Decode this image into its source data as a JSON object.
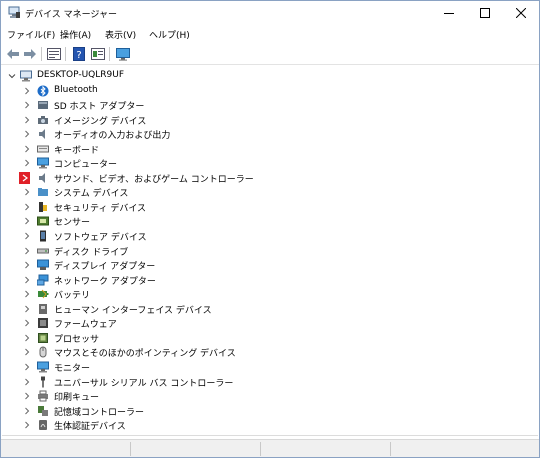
{
  "window": {
    "title": "デバイス マネージャー",
    "icon": "device-manager-icon",
    "controls": [
      "minimize-icon",
      "maximize-icon",
      "close-icon"
    ]
  },
  "menu": {
    "items": [
      "ファイル(F)",
      "操作(A)",
      "表示(V)",
      "ヘルプ(H)"
    ]
  },
  "toolbar": {
    "buttons": [
      "back-arrow-icon",
      "forward-arrow-icon",
      "properties-icon",
      "help-icon",
      "view-icon",
      "monitor-icon"
    ]
  },
  "tree": {
    "root": {
      "label": "DESKTOP-UQLR9UF",
      "expanded": true,
      "icon": "computer-icon"
    },
    "items": [
      {
        "label": "Bluetooth",
        "icon": "bluetooth-icon"
      },
      {
        "label": "SD ホスト アダプター",
        "icon": "sd-card-icon"
      },
      {
        "label": "イメージング デバイス",
        "icon": "camera-icon"
      },
      {
        "label": "オーディオの入力および出力",
        "icon": "speaker-icon"
      },
      {
        "label": "キーボード",
        "icon": "keyboard-icon"
      },
      {
        "label": "コンピューター",
        "icon": "monitor-icon"
      },
      {
        "label": "サウンド、ビデオ、およびゲーム コントローラー",
        "icon": "speaker-icon",
        "highlight": true
      },
      {
        "label": "システム デバイス",
        "icon": "folder-chip-icon"
      },
      {
        "label": "セキュリティ デバイス",
        "icon": "security-key-icon"
      },
      {
        "label": "センサー",
        "icon": "sensor-icon"
      },
      {
        "label": "ソフトウェア デバイス",
        "icon": "phone-device-icon"
      },
      {
        "label": "ディスク ドライブ",
        "icon": "disk-drive-icon"
      },
      {
        "label": "ディスプレイ アダプター",
        "icon": "display-adapter-icon"
      },
      {
        "label": "ネットワーク アダプター",
        "icon": "network-icon"
      },
      {
        "label": "バッテリ",
        "icon": "battery-icon"
      },
      {
        "label": "ヒューマン インターフェイス デバイス",
        "icon": "hid-icon"
      },
      {
        "label": "ファームウェア",
        "icon": "firmware-icon"
      },
      {
        "label": "プロセッサ",
        "icon": "processor-icon"
      },
      {
        "label": "マウスとそのほかのポインティング デバイス",
        "icon": "mouse-icon"
      },
      {
        "label": "モニター",
        "icon": "monitor-icon"
      },
      {
        "label": "ユニバーサル シリアル バス コントローラー",
        "icon": "usb-icon"
      },
      {
        "label": "印刷キュー",
        "icon": "printer-icon"
      },
      {
        "label": "記憶域コントローラー",
        "icon": "storage-controller-icon"
      },
      {
        "label": "生体認証デバイス",
        "icon": "fingerprint-icon"
      }
    ]
  },
  "colors": {
    "highlight_expander": "#e02028",
    "border": "#8aa2c3",
    "accent_blue": "#2b73c8"
  }
}
